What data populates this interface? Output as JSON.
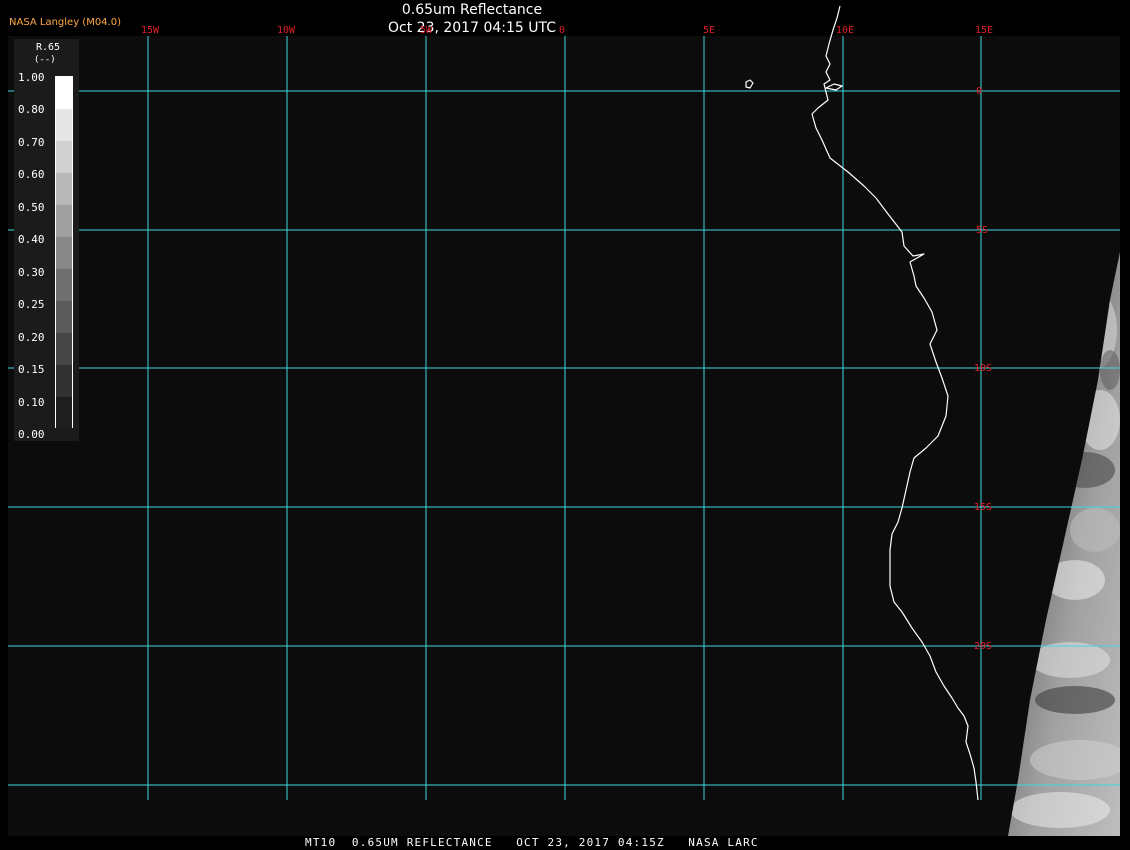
{
  "header": {
    "title": "0.65um Reflectance",
    "timestamp": "Oct 23, 2017 04:15 UTC",
    "brand": "NASA Langley (M04.0)"
  },
  "map": {
    "longitude_labels": [
      "15W",
      "10W",
      "5W",
      "0",
      "5E",
      "10E",
      "15E"
    ],
    "latitude_labels": [
      "0",
      "5S",
      "10S",
      "15S",
      "20S"
    ],
    "colors": {
      "gridline": "#3fd6dc",
      "grid_label": "#e0202a",
      "coastline": "#ffffff",
      "background": "#0c0c0c"
    }
  },
  "legend": {
    "variable": "R.65",
    "unit": "(--)",
    "ticks": [
      "1.00",
      "0.80",
      "0.70",
      "0.60",
      "0.50",
      "0.40",
      "0.30",
      "0.25",
      "0.20",
      "0.15",
      "0.10",
      "0.00"
    ],
    "ramp_colors": [
      "#ffffff",
      "#e6e6e6",
      "#d0d0d0",
      "#b8b8b8",
      "#a0a0a0",
      "#888888",
      "#707070",
      "#5a5a5a",
      "#464646",
      "#323232",
      "#1e1e1e"
    ]
  },
  "footer": {
    "caption": "MT10  0.65UM REFLECTANCE   OCT 23, 2017 04:15Z   NASA LARC"
  }
}
